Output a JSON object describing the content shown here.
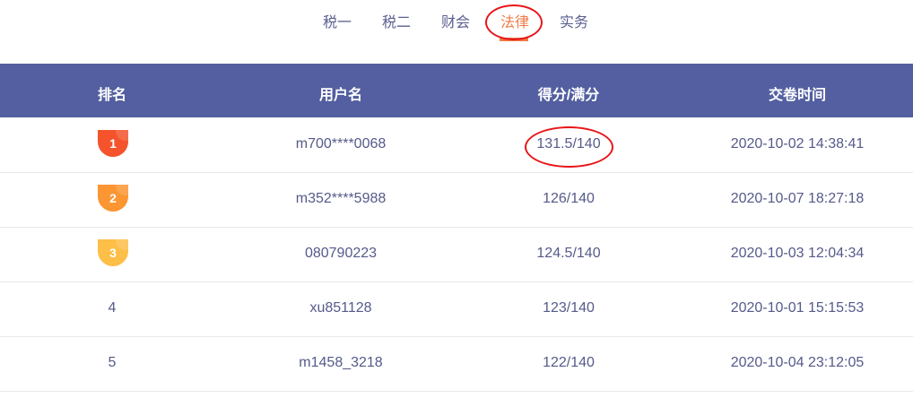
{
  "tabs": [
    {
      "label": "税一"
    },
    {
      "label": "税二"
    },
    {
      "label": "财会"
    },
    {
      "label": "法律",
      "active": true
    },
    {
      "label": "实务"
    }
  ],
  "columns": [
    "排名",
    "用户名",
    "得分/满分",
    "交卷时间"
  ],
  "rows": [
    {
      "rank": "1",
      "user": "m700****0068",
      "score": "131.5/140",
      "time": "2020-10-02 14:38:41",
      "badge_color": "#f4532c"
    },
    {
      "rank": "2",
      "user": "m352****5988",
      "score": "126/140",
      "time": "2020-10-07 18:27:18",
      "badge_color": "#fb9632"
    },
    {
      "rank": "3",
      "user": "080790223",
      "score": "124.5/140",
      "time": "2020-10-03 12:04:34",
      "badge_color": "#fdbf48"
    },
    {
      "rank": "4",
      "user": "xu851128",
      "score": "123/140",
      "time": "2020-10-01 15:15:53"
    },
    {
      "rank": "5",
      "user": "m1458_3218",
      "score": "122/140",
      "time": "2020-10-04 23:12:05"
    }
  ],
  "colors": {
    "header": "#535fa0",
    "accent": "#f07a45",
    "annotation": "#e8161a"
  }
}
